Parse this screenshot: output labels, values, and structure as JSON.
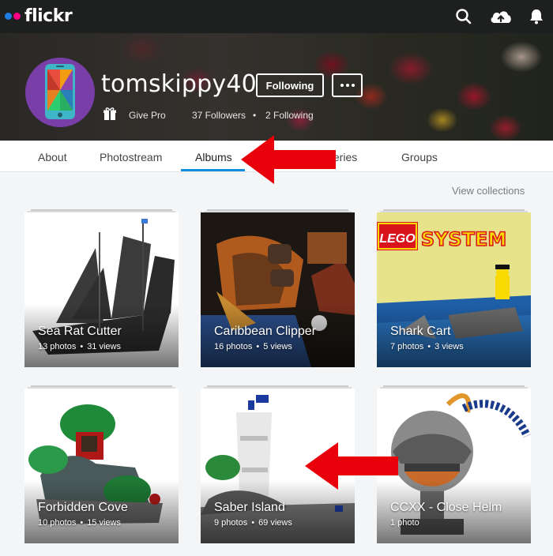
{
  "app": {
    "logo_text": "flickr",
    "brand_colors": {
      "blue": "#1e7be0",
      "pink": "#ff0084",
      "accent": "#128fdc"
    }
  },
  "topbar": {
    "icons": [
      "search-icon",
      "upload-cloud-icon",
      "notifications-bell-icon"
    ]
  },
  "profile": {
    "username": "tomskippy40",
    "following_button": "Following",
    "more_button_icon": "ellipsis-icon",
    "give_pro": "Give Pro",
    "followers": "37 Followers",
    "following_count": "2 Following",
    "separator": "•"
  },
  "nav": {
    "tabs": [
      {
        "label": "About"
      },
      {
        "label": "Photostream"
      },
      {
        "label": "Albums",
        "active": true
      },
      {
        "label": "Galleries"
      },
      {
        "label": "Groups"
      }
    ]
  },
  "view_collections": "View collections",
  "albums": [
    {
      "title": "Sea Rat Cutter",
      "photos": "13 photos",
      "views": "31 views"
    },
    {
      "title": "Caribbean Clipper",
      "photos": "16 photos",
      "views": "5 views"
    },
    {
      "title": "Shark Cart",
      "photos": "7 photos",
      "views": "3 views"
    },
    {
      "title": "Forbidden Cove",
      "photos": "10 photos",
      "views": "15 views"
    },
    {
      "title": "Saber Island",
      "photos": "9 photos",
      "views": "69 views"
    },
    {
      "title": "CCXX - Close Helm",
      "photos": "1 photo",
      "views": ""
    }
  ],
  "album_meta_separator": "•",
  "thumb_text": {
    "shark_cart_logo_1": "LEGO",
    "shark_cart_logo_2": "SYSTEM"
  },
  "annotation_arrow_color": "#e8000b"
}
